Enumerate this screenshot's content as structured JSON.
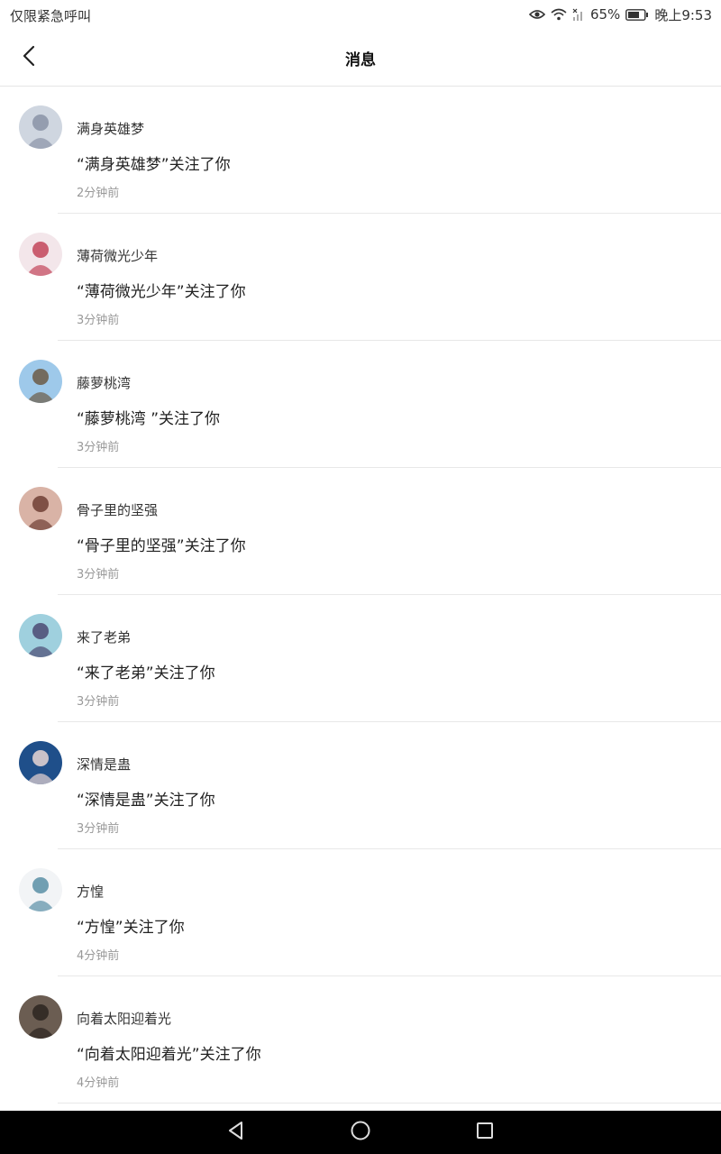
{
  "status_bar": {
    "left_text": "仅限紧急呼叫",
    "battery": "65%",
    "time": "晚上9:53"
  },
  "header": {
    "title": "消息",
    "back_icon": "chevron-left-icon"
  },
  "notifications": [
    {
      "name": "满身英雄梦",
      "message": "“满身英雄梦”关注了你",
      "time": "2分钟前",
      "avatar_colors": [
        "#cfd6e0",
        "#8a93a6"
      ]
    },
    {
      "name": "薄荷微光少年",
      "message": "“薄荷微光少年”关注了你",
      "time": "3分钟前",
      "avatar_colors": [
        "#f3e6ea",
        "#c2455a"
      ]
    },
    {
      "name": "藤萝桃湾",
      "message": "“藤萝桃湾 ”关注了你",
      "time": "3分钟前",
      "avatar_colors": [
        "#9ec9ea",
        "#6b5a45"
      ]
    },
    {
      "name": "骨子里的坚强",
      "message": "“骨子里的坚强”关注了你",
      "time": "3分钟前",
      "avatar_colors": [
        "#d9b3a6",
        "#6e3e34"
      ]
    },
    {
      "name": "来了老弟",
      "message": "“来了老弟”关注了你",
      "time": "3分钟前",
      "avatar_colors": [
        "#9fd0de",
        "#4b4a73"
      ]
    },
    {
      "name": "深情是蛊",
      "message": "“深情是蛊”关注了你",
      "time": "3分钟前",
      "avatar_colors": [
        "#1f4f8a",
        "#e9d6d3"
      ]
    },
    {
      "name": "方惶",
      "message": "“方惶”关注了你",
      "time": "4分钟前",
      "avatar_colors": [
        "#f2f4f6",
        "#5a8fa6"
      ]
    },
    {
      "name": "向着太阳迎着光",
      "message": "“向着太阳迎着光”关注了你",
      "time": "4分钟前",
      "avatar_colors": [
        "#6b5d52",
        "#2b2420"
      ]
    }
  ],
  "nav_bar": {
    "back_icon": "triangle-back-icon",
    "home_icon": "circle-home-icon",
    "recents_icon": "square-recents-icon"
  }
}
